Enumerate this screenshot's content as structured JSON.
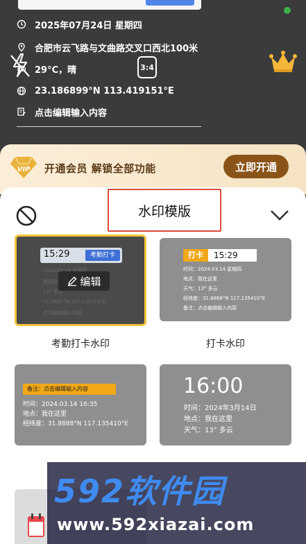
{
  "info": {
    "date": "2025年07月24日 星期四",
    "address": "合肥市云飞路与文曲路交叉口西北100米",
    "weather": "29°C，晴",
    "coords": "23.186899°N 113.419151°E",
    "note": "点击编辑输入内容"
  },
  "camera": {
    "ratio": "3:4"
  },
  "vip": {
    "text": "开通会员 解锁全部功能",
    "button": "立即开通"
  },
  "sheet": {
    "title": "水印模版"
  },
  "templates": [
    {
      "label": "考勤打卡水印",
      "time": "15:29",
      "badge": "考勤打卡",
      "edit": "编辑",
      "lines": [
        "2024.03.14 星期四",
        "我在这里",
        "13° 多云",
        "31.8888°N 117.135410°E",
        "点击编辑输入内容"
      ]
    },
    {
      "label": "打卡水印",
      "tag": "打卡",
      "time": "15:29",
      "lines": [
        "时间：2024.03.14 星期四",
        "地点：我在这里",
        "天气：13° 多云",
        "经纬度：31.8888°N 117.135410°E",
        "备注：点击编辑输入内容"
      ]
    },
    {
      "tag": "备注：点击编辑输入内容",
      "lines": [
        "时间：2024.03.14  16:35",
        "地点：我在这里",
        "经纬度：31.8888°N  117.135410°E"
      ]
    },
    {
      "time": "16:00",
      "lines": [
        "时间：2024年3月14日",
        "地点：我在这里",
        "天气：13° 多云"
      ]
    }
  ],
  "watermark": {
    "brand": "592软件园",
    "url": "www.592xiazai.com"
  },
  "colors": {
    "vip_button": "#8a5418",
    "highlight": "#f3c43c",
    "title_box": "#e04a3a",
    "badge_blue": "#3d6fd6",
    "tag_orange": "#f1a817"
  }
}
